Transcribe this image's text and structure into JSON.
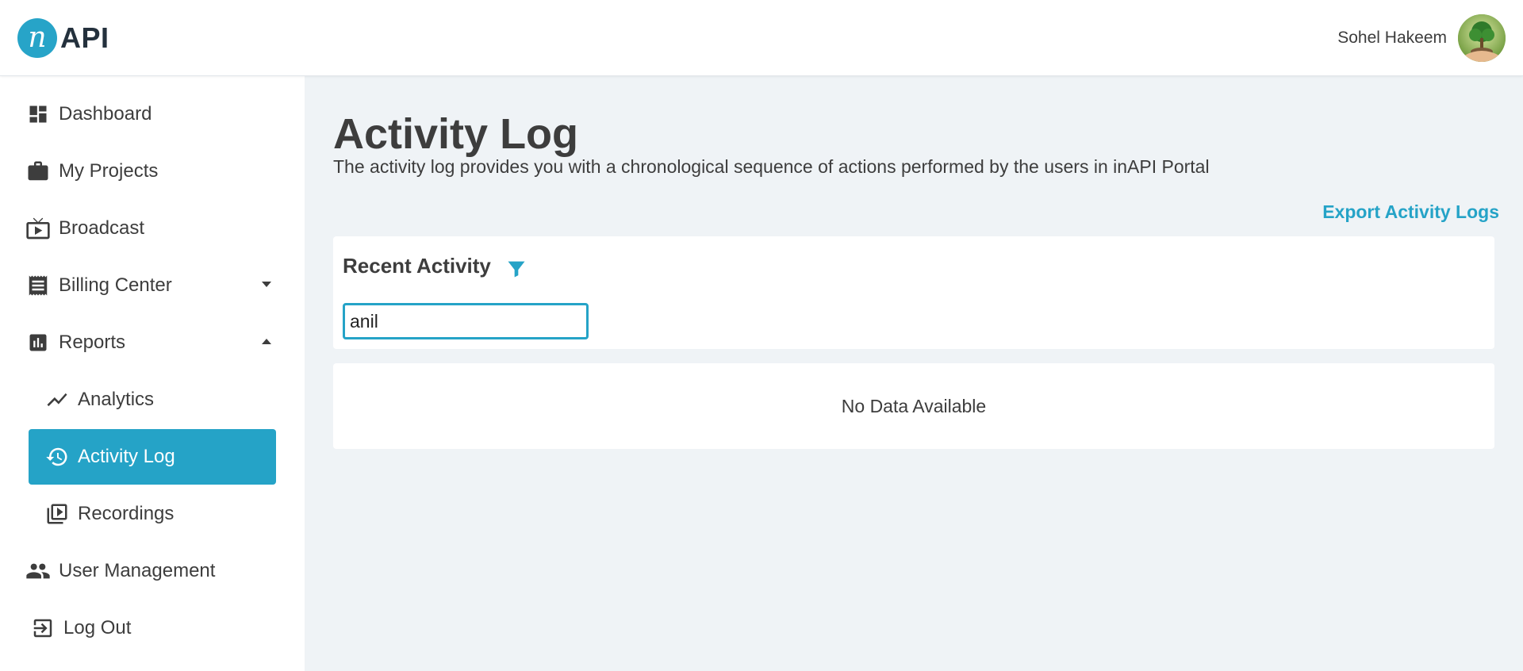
{
  "header": {
    "logo_letter": "n",
    "logo_text": "API",
    "user_name": "Sohel Hakeem"
  },
  "sidebar": {
    "items": [
      {
        "label": "Dashboard",
        "icon": "dashboard-icon"
      },
      {
        "label": "My Projects",
        "icon": "briefcase-icon"
      },
      {
        "label": "Broadcast",
        "icon": "tv-play-icon"
      },
      {
        "label": "Billing Center",
        "icon": "receipt-icon",
        "expandable": true,
        "expanded": false
      },
      {
        "label": "Reports",
        "icon": "bar-chart-icon",
        "expandable": true,
        "expanded": true
      },
      {
        "label": "Analytics",
        "icon": "trend-line-icon",
        "sub": true
      },
      {
        "label": "Activity Log",
        "icon": "history-icon",
        "sub": true,
        "active": true
      },
      {
        "label": "Recordings",
        "icon": "video-library-icon",
        "sub": true
      },
      {
        "label": "User Management",
        "icon": "users-icon"
      },
      {
        "label": "Log Out",
        "icon": "logout-icon"
      }
    ]
  },
  "main": {
    "title": "Activity Log",
    "description": "The activity log provides you with a chronological sequence of actions performed by the users in inAPI Portal",
    "export_label": "Export Activity Logs",
    "recent_title": "Recent Activity",
    "search_value": "anil",
    "empty_text": "No Data Available"
  },
  "colors": {
    "accent": "#25a3c7",
    "page_bg": "#eff3f6",
    "text": "#3d3d3d"
  }
}
